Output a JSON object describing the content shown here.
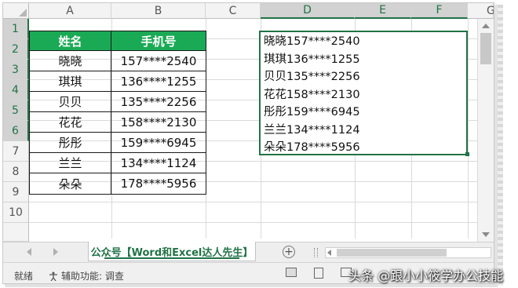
{
  "columns": [
    "A",
    "B",
    "C",
    "D",
    "E",
    "F",
    "G"
  ],
  "rows": [
    "1",
    "2",
    "3",
    "4",
    "5",
    "6",
    "7",
    "8",
    "9",
    "10"
  ],
  "table": {
    "headers": [
      "姓名",
      "手机号"
    ],
    "data": [
      [
        "晓晓",
        "157****2540"
      ],
      [
        "琪琪",
        "136****1255"
      ],
      [
        "贝贝",
        "135****2256"
      ],
      [
        "花花",
        "158****2130"
      ],
      [
        "彤彤",
        "159****6945"
      ],
      [
        "兰兰",
        "134****1124"
      ],
      [
        "朵朵",
        "178****5956"
      ]
    ]
  },
  "textbox_lines": [
    "晓晓157****2540",
    "琪琪136****1255",
    "贝贝135****2256",
    "花花158****2130",
    "彤彤159****6945",
    "兰兰134****1124",
    "朵朵178****5956"
  ],
  "sheet_tab": "公众号【Word和Excel达人先生】",
  "add_sheet_symbol": "+",
  "status": {
    "ready": "就绪",
    "accessibility": "辅助功能: 调查"
  },
  "watermark": "头条 @跟小小筱学办公技能",
  "colors": {
    "header_green": "#1aaa55",
    "excel_green": "#217346"
  }
}
